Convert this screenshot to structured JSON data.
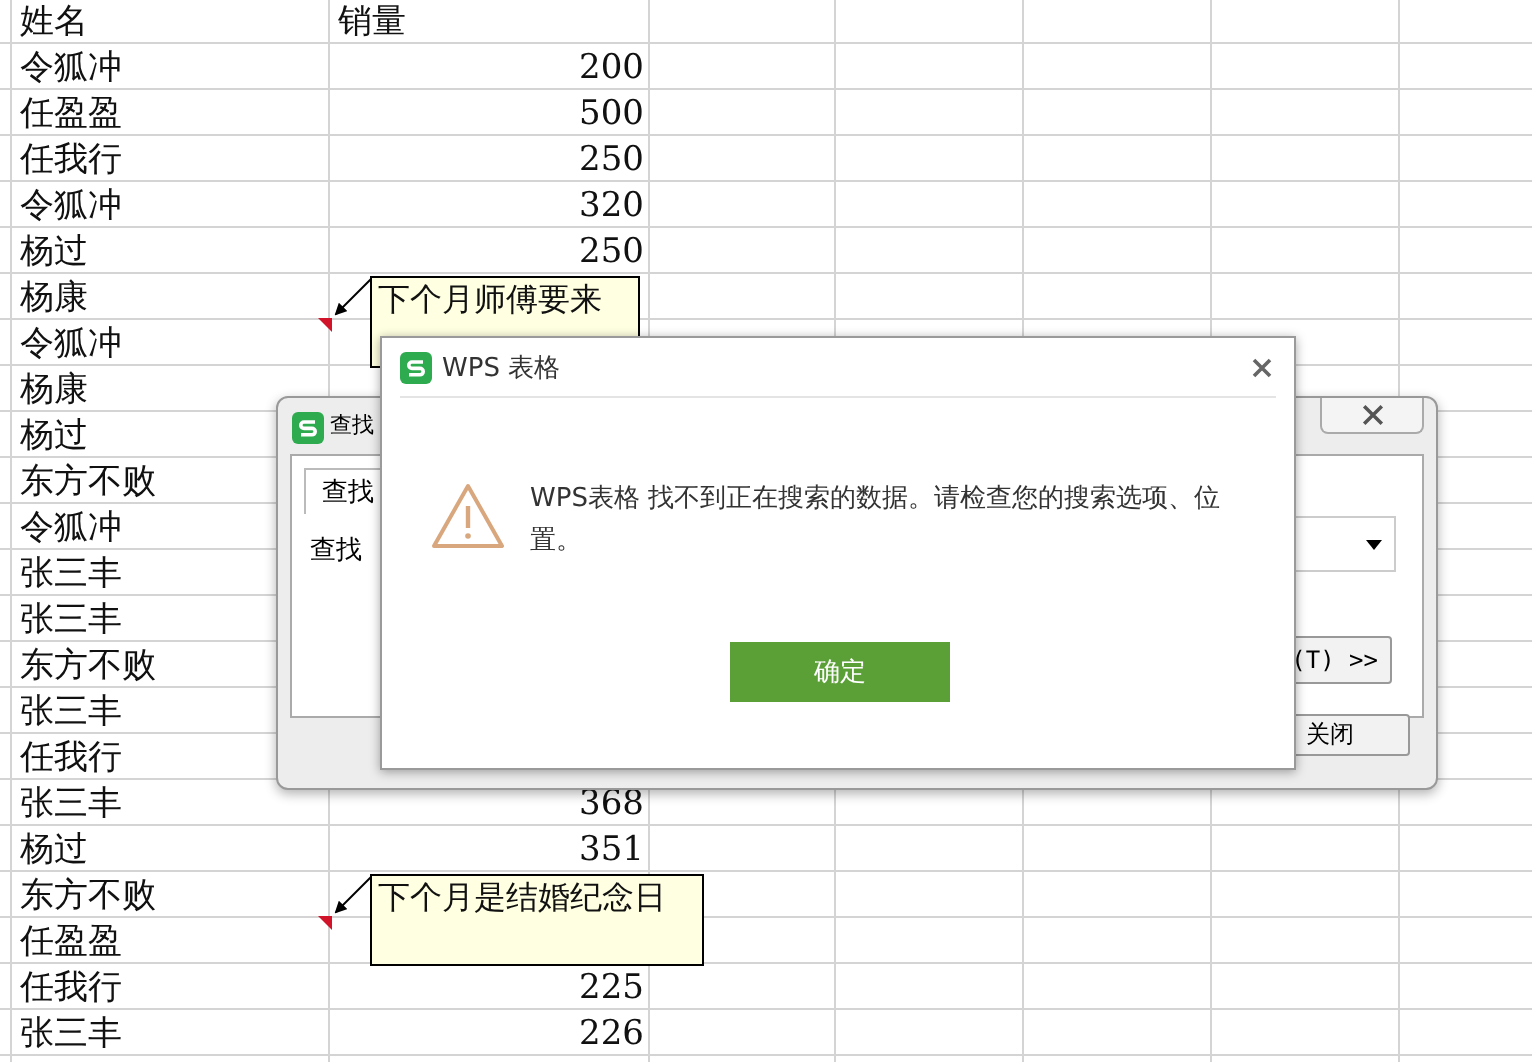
{
  "sheet": {
    "columns": [
      "姓名",
      "销量"
    ],
    "rows": [
      {
        "name": "令狐冲",
        "sales": "200"
      },
      {
        "name": "任盈盈",
        "sales": "500"
      },
      {
        "name": "任我行",
        "sales": "250"
      },
      {
        "name": "令狐冲",
        "sales": "320"
      },
      {
        "name": "杨过",
        "sales": "250"
      },
      {
        "name": "杨康"
      },
      {
        "name": "令狐冲",
        "comment": "下个月师傅要来"
      },
      {
        "name": "杨康"
      },
      {
        "name": "杨过"
      },
      {
        "name": "东方不败"
      },
      {
        "name": "令狐冲"
      },
      {
        "name": "张三丰"
      },
      {
        "name": "张三丰"
      },
      {
        "name": "东方不败"
      },
      {
        "name": "张三丰"
      },
      {
        "name": "任我行"
      },
      {
        "name": "张三丰",
        "sales": "368"
      },
      {
        "name": "杨过",
        "sales": "351"
      },
      {
        "name": "东方不败"
      },
      {
        "name": "任盈盈",
        "comment": "下个月是结婚纪念日"
      },
      {
        "name": "任我行",
        "sales": "225"
      },
      {
        "name": "张三丰",
        "sales": "226"
      }
    ]
  },
  "find_dialog": {
    "title": "查找",
    "tab": "查找",
    "label": "查找",
    "options_button": "(T) >>",
    "close_button": "关闭"
  },
  "alert": {
    "title": "WPS 表格",
    "message": "WPS表格 找不到正在搜索的数据。请检查您的搜索选项、位置。",
    "ok_button": "确定"
  }
}
